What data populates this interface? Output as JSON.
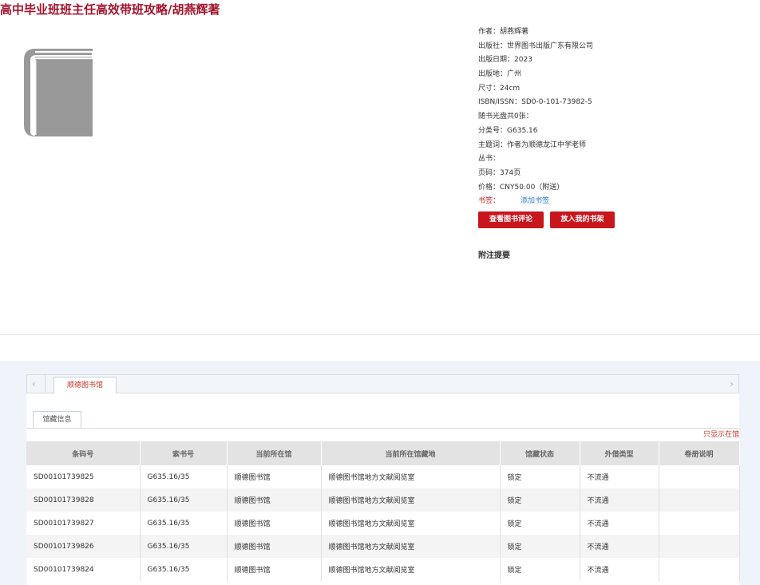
{
  "book": {
    "title": "高中毕业班班主任高效带班攻略/胡燕辉著"
  },
  "cover": {
    "icon": "book-icon",
    "color": "#999999"
  },
  "meta": [
    {
      "label": "作者：",
      "value": "胡燕辉著"
    },
    {
      "label": "出版社：",
      "value": "世界图书出版广东有限公司"
    },
    {
      "label": "出版日期：",
      "value": "2023"
    },
    {
      "label": "出版地：",
      "value": "广州"
    },
    {
      "label": "尺寸：",
      "value": "24cm"
    },
    {
      "label": "ISBN/ISSN：",
      "value": "SD0-0-101-73982-5"
    },
    {
      "label": "随书光盘共0张：",
      "value": ""
    },
    {
      "label": "分类号：",
      "value": "G635.16"
    },
    {
      "label": "主题词：",
      "value": "作者为顺德龙江中学老师"
    },
    {
      "label": "丛书：",
      "value": ""
    },
    {
      "label": "页码：",
      "value": "374页"
    },
    {
      "label": "价格：",
      "value": "CNY50.00（附送）"
    }
  ],
  "bookmark": {
    "label": "书签：",
    "add_label": "添加书签"
  },
  "buttons": {
    "review": "查看图书评论",
    "shelf": "放入我的书架"
  },
  "notes_title": "附注提要",
  "tabs": {
    "library": "顺德图书馆",
    "holdings": "馆藏信息",
    "only_this": "只显示在馆"
  },
  "holdings": {
    "columns": [
      "条码号",
      "索书号",
      "当前所在馆",
      "当前所在馆藏地",
      "馆藏状态",
      "外借类型",
      "卷册说明"
    ],
    "rows": [
      [
        "SD00101739825",
        "G635.16/35",
        "顺德图书馆",
        "顺德图书馆地方文献阅览室",
        "锁定",
        "不流通",
        ""
      ],
      [
        "SD00101739828",
        "G635.16/35",
        "顺德图书馆",
        "顺德图书馆地方文献阅览室",
        "锁定",
        "不流通",
        ""
      ],
      [
        "SD00101739827",
        "G635.16/35",
        "顺德图书馆",
        "顺德图书馆地方文献阅览室",
        "锁定",
        "不流通",
        ""
      ],
      [
        "SD00101739826",
        "G635.16/35",
        "顺德图书馆",
        "顺德图书馆地方文献阅览室",
        "锁定",
        "不流通",
        ""
      ],
      [
        "SD00101739824",
        "G635.16/35",
        "顺德图书馆",
        "顺德图书馆地方文献阅览室",
        "锁定",
        "不流通",
        ""
      ]
    ]
  }
}
